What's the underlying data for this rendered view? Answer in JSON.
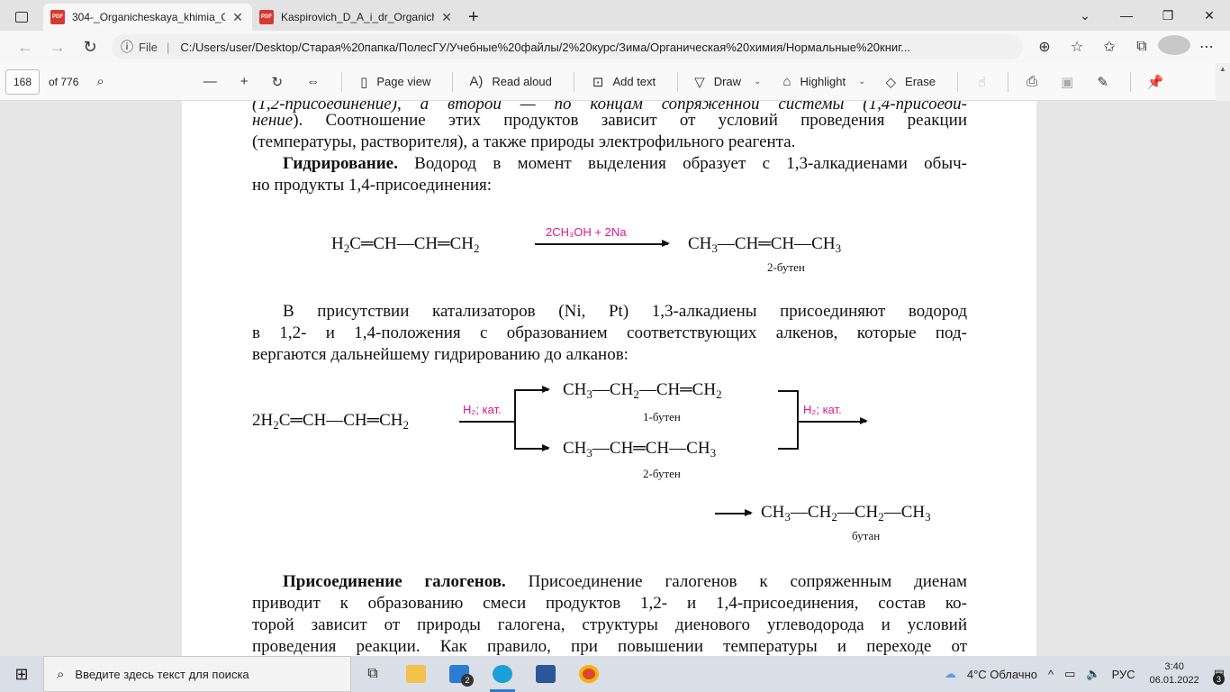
{
  "tabs": [
    {
      "title": "304-_Organicheskaya_khimia_Ch",
      "active": true
    },
    {
      "title": "Kaspirovich_D_A_i_dr_Organiche",
      "active": false
    }
  ],
  "addressbar": {
    "protocol_label": "File",
    "url": "C:/Users/user/Desktop/Старая%20папка/ПолесГУ/Учебные%20файлы/2%20курс/Зима/Органическая%20химия/Нормальные%20книг..."
  },
  "pdf_toolbar": {
    "page_number": "168",
    "page_total": "of 776",
    "page_view": "Page view",
    "read_aloud": "Read aloud",
    "add_text": "Add text",
    "draw": "Draw",
    "highlight": "Highlight",
    "erase": "Erase"
  },
  "document": {
    "line1_a": "(1,2-присоединение), а второй — по концам сопряженной системы (1,4-присоеди-",
    "line2_italic": "нение",
    "line2_rest": "). Соотношение этих продуктов зависит от условий проведения реакции",
    "line3": "(температуры, растворителя), а также природы электрофильного реагента.",
    "hydro_bold": "Гидрирование.",
    "hydro_rest": " Водород в момент выделения образует с 1,3-алкадиенами обыч-",
    "line5": "но продукты 1,4-присоединения:",
    "r1_reagent": "2CH₃OH + 2Na",
    "r1_product_caption": "2-бутен",
    "p2_line1": "В присутствии катализаторов (Ni, Pt) 1,3-алкадиены присоединяют водород",
    "p2_line2": "в 1,2- и 1,4-положения с образованием соответствующих алкенов, которые под-",
    "p2_line3": "вергаются дальнейшему гидрированию до алканов:",
    "r2_reagent1": "H₂; кат.",
    "r2_reagent2": "H₂; кат.",
    "r2_top_caption": "1-бутен",
    "r2_bottom_caption": "2-бутен",
    "r2_final_caption": "бутан",
    "halo_bold": "Присоединение галогенов.",
    "halo_rest": " Присоединение галогенов к сопряженным диенам",
    "p3_line2": "приводит к образованию смеси продуктов 1,2- и 1,4-присоединения, состав ко-",
    "p3_line3": "торой зависит от природы галогена, структуры диенового углеводорода и условий",
    "p3_line4": "проведения реакции. Как правило, при повышении температуры и переходе от"
  },
  "taskbar": {
    "search_placeholder": "Введите здесь текст для поиска",
    "mail_badge": "2",
    "weather": "4°C  Облачно",
    "language": "РУС",
    "time": "3:40",
    "date": "06.01.2022",
    "notif_badge": "3"
  },
  "colors": {
    "reagent": "#e2168d",
    "pdf_icon": "#d8382f",
    "taskbar": "#dadee6"
  }
}
